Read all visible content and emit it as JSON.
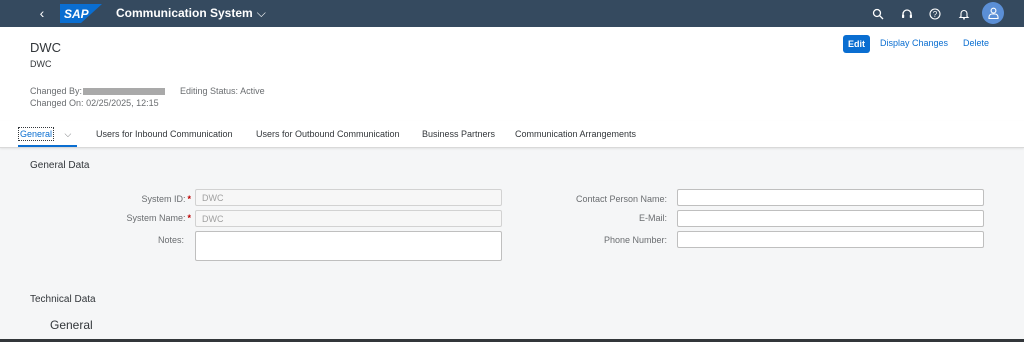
{
  "shell": {
    "brand": "SAP",
    "back_symbol": "‹",
    "title": "Communication System",
    "title_chevron": "⌵",
    "icons": [
      "search-icon",
      "headset-icon",
      "help-icon",
      "notification-icon",
      "user-avatar-icon"
    ],
    "colors": {
      "bar": "#354a5f",
      "logo": "#0a6ed1",
      "avatar": "#5b8fd6"
    }
  },
  "header": {
    "title": "DWC",
    "subtitle": "DWC",
    "changed_by_label": "Changed By:",
    "changed_on_label": "Changed On:",
    "changed_on_value": "02/25/2025, 12:15",
    "editing_status_label": "Editing Status:",
    "editing_status_value": "Active",
    "actions": {
      "edit": "Edit",
      "display_changes": "Display Changes",
      "delete": "Delete"
    }
  },
  "tabs": [
    {
      "label": "General",
      "active": true
    },
    {
      "label": "Users for Inbound Communication"
    },
    {
      "label": "Users for Outbound Communication"
    },
    {
      "label": "Business Partners"
    },
    {
      "label": "Communication Arrangements"
    }
  ],
  "sections": {
    "general_data": {
      "title": "General Data",
      "fields": {
        "system_id": {
          "label": "System ID:",
          "value": "DWC",
          "required": "*"
        },
        "system_name": {
          "label": "System Name:",
          "value": "DWC",
          "required": "*"
        },
        "notes": {
          "label": "Notes:",
          "value": ""
        },
        "contact_person": {
          "label": "Contact Person Name:",
          "value": ""
        },
        "email": {
          "label": "E-Mail:",
          "value": ""
        },
        "phone": {
          "label": "Phone Number:",
          "value": ""
        }
      }
    },
    "technical_data": {
      "title": "Technical Data",
      "subsection": "General"
    }
  }
}
